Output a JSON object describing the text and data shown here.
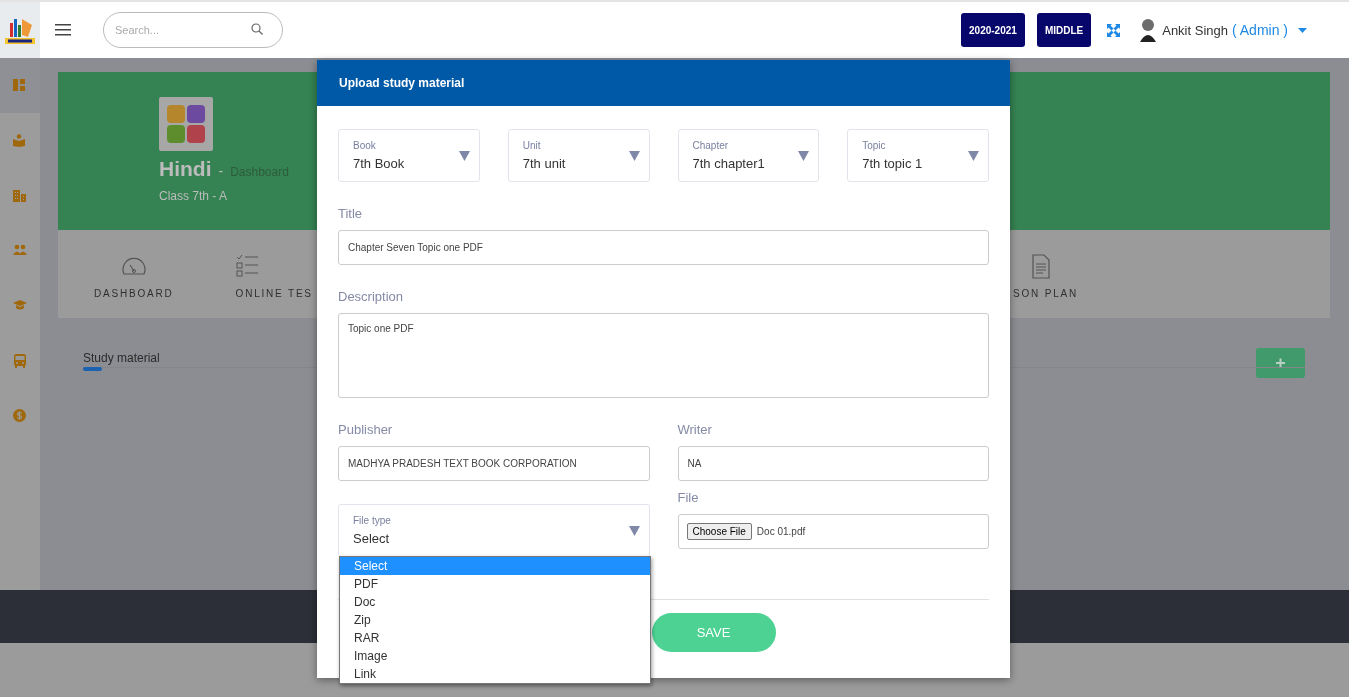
{
  "header": {
    "search": {
      "placeholder": "Search..."
    },
    "session_button": "2020-2021",
    "level_button": "MIDDLE",
    "user": {
      "name": "Ankit Singh",
      "role": "( Admin )"
    }
  },
  "sidebar": {
    "items": [
      {
        "kind": "dashboard",
        "selected": true
      },
      {
        "kind": "reader",
        "selected": false
      },
      {
        "kind": "building",
        "selected": false
      },
      {
        "kind": "people",
        "selected": false
      },
      {
        "kind": "cap",
        "selected": false
      },
      {
        "kind": "bus",
        "selected": false
      },
      {
        "kind": "coin",
        "selected": false
      }
    ]
  },
  "subject": {
    "title": "Hindi",
    "separator": "-",
    "subtitle": "Dashboard",
    "class": "Class 7th - A"
  },
  "nav": [
    {
      "label": "DASHBOARD",
      "kind": "gauge"
    },
    {
      "label": "ONLINE TES",
      "kind": "checklist"
    },
    {
      "label": "SON PLAN",
      "kind": "document"
    }
  ],
  "section": {
    "title": "Study material",
    "add_button": "+"
  },
  "modal": {
    "title": "Upload study material",
    "selects": [
      {
        "label": "Book",
        "value": "7th Book"
      },
      {
        "label": "Unit",
        "value": "7th unit"
      },
      {
        "label": "Chapter",
        "value": "7th chapter1"
      },
      {
        "label": "Topic",
        "value": "7th topic 1"
      }
    ],
    "title_field": {
      "label": "Title",
      "value": "Chapter Seven Topic one PDF"
    },
    "description": {
      "label": "Description",
      "value": "Topic one PDF"
    },
    "publisher": {
      "label": "Publisher",
      "value": "MADHYA PRADESH TEXT BOOK CORPORATION"
    },
    "writer": {
      "label": "Writer",
      "value": "NA"
    },
    "file_type": {
      "label": "File type",
      "value": "Select",
      "options": [
        {
          "label": "Select",
          "selected": true
        },
        {
          "label": "PDF",
          "selected": false
        },
        {
          "label": "Doc",
          "selected": false
        },
        {
          "label": "Zip",
          "selected": false
        },
        {
          "label": "RAR",
          "selected": false
        },
        {
          "label": "Image",
          "selected": false
        },
        {
          "label": "Link",
          "selected": false
        }
      ]
    },
    "file": {
      "label": "File",
      "button": "Choose File",
      "filename": "Doc 01.pdf"
    },
    "save_button": "SAVE"
  }
}
